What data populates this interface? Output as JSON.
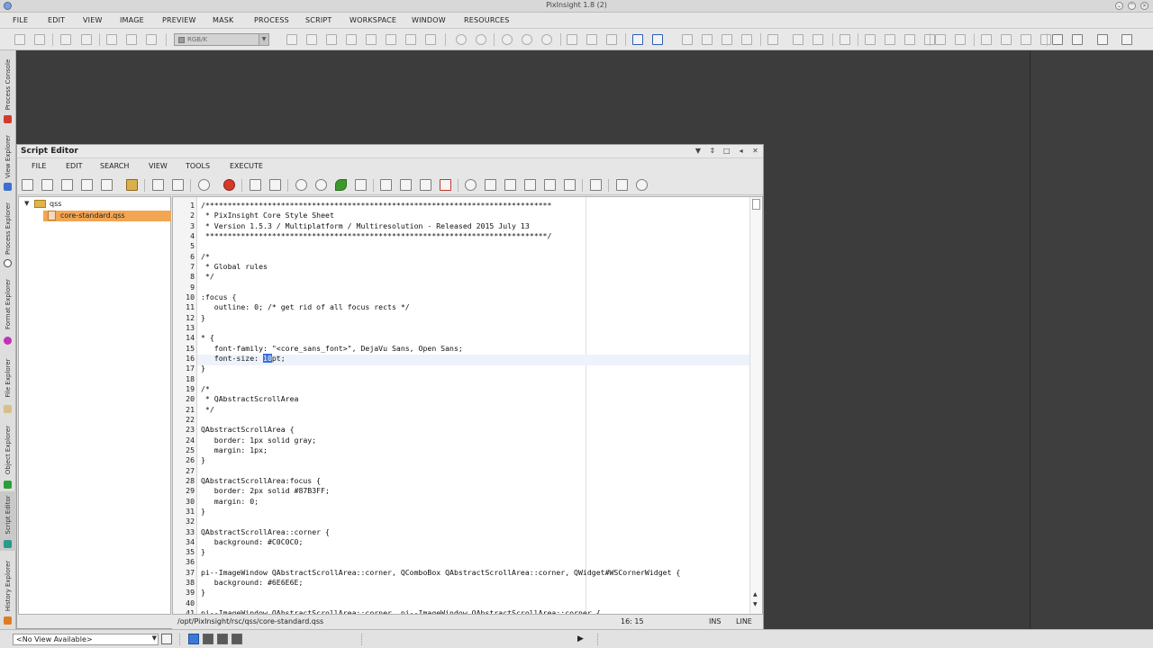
{
  "window": {
    "title": "PixInsight 1.8 (2)"
  },
  "menubar": {
    "items": [
      "FILE",
      "EDIT",
      "VIEW",
      "IMAGE",
      "PREVIEW",
      "MASK",
      "PROCESS",
      "SCRIPT",
      "WORKSPACE",
      "WINDOW",
      "RESOURCES"
    ]
  },
  "toolbar": {
    "colorspace": "RGB/K"
  },
  "sidebar": {
    "tabs": [
      "Process Console",
      "View Explorer",
      "Process Explorer",
      "Format Explorer",
      "File Explorer",
      "Object Explorer",
      "Script Editor",
      "History Explorer"
    ]
  },
  "script_editor": {
    "title": "Script Editor",
    "menu": [
      "FILE",
      "EDIT",
      "SEARCH",
      "VIEW",
      "TOOLS",
      "EXECUTE"
    ],
    "tree": {
      "folder": "qss",
      "file": "core-standard.qss"
    },
    "lines": [
      "/******************************************************************************",
      " * PixInsight Core Style Sheet",
      " * Version 1.5.3 / Multiplatform / Multiresolution - Released 2015 July 13",
      " *****************************************************************************/",
      "",
      "/*",
      " * Global rules",
      " */",
      "",
      ":focus {",
      "   outline: 0; /* get rid of all focus rects */",
      "}",
      "",
      "* {",
      "   font-family: \"<core_sans_font>\", DejaVu Sans, Open Sans;",
      "   font-size: 10pt;",
      "}",
      "",
      "/*",
      " * QAbstractScrollArea",
      " */",
      "",
      "QAbstractScrollArea {",
      "   border: 1px solid gray;",
      "   margin: 1px;",
      "}",
      "",
      "QAbstractScrollArea:focus {",
      "   border: 2px solid #87B3FF;",
      "   margin: 0;",
      "}",
      "",
      "QAbstractScrollArea::corner {",
      "   background: #C0C0C0;",
      "}",
      "",
      "pi--ImageWindow QAbstractScrollArea::corner, QComboBox QAbstractScrollArea::corner, QWidget#WSCornerWidget {",
      "   background: #6E6E6E;",
      "}",
      "",
      "pi--ImageWindow QAbstractScrollArea::corner, pi--ImageWindow QAbstractScrollArea::corner {"
    ],
    "status": {
      "path": "/opt/PixInsight/rsc/qss/core-standard.qss",
      "position": "16: 15",
      "mode": "INS",
      "linemode": "LINE"
    }
  },
  "statusbar": {
    "view_selector": "<No View Available>"
  },
  "colors": {
    "selection": "#F3A652",
    "caret_highlight": "#3B6FD8"
  }
}
